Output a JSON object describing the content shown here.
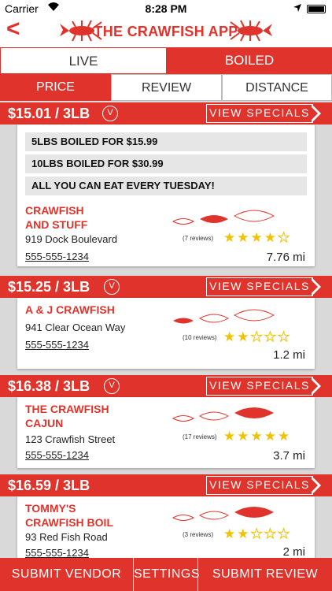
{
  "status": {
    "carrier": "Carrier",
    "time": "8:28 PM"
  },
  "header": {
    "title": "THE CRAWFISH APP"
  },
  "tabs": [
    {
      "label": "LIVE",
      "active": false
    },
    {
      "label": "BOILED",
      "active": true
    }
  ],
  "sort_tabs": [
    {
      "label": "PRICE",
      "active": true
    },
    {
      "label": "REVIEW",
      "active": false
    },
    {
      "label": "DISTANCE",
      "active": false
    }
  ],
  "specials_label": "VIEW SPECIALS",
  "vendors": [
    {
      "price": "$15.01 / 3LB",
      "specials": [
        "5LBS BOILED FOR $15.99",
        "10LBS BOILED FOR $30.99",
        "ALL YOU CAN EAT EVERY TUESDAY!"
      ],
      "name_line1": "CRAWFISH",
      "name_line2": "AND STUFF",
      "address": "919 Dock Boulevard",
      "phone": "555-555-1234",
      "reviews": "(7 reviews)",
      "rating": 4,
      "distance": "7.76 mi",
      "size_highlight": 2
    },
    {
      "price": "$15.25 / 3LB",
      "specials": [],
      "name_line1": "A & J CRAWFISH",
      "name_line2": "",
      "address": "941 Clear Ocean Way",
      "phone": "555-555-1234",
      "reviews": "(10 reviews)",
      "rating": 2,
      "distance": "1.2 mi",
      "size_highlight": 1
    },
    {
      "price": "$16.38 / 3LB",
      "specials": [],
      "name_line1": "THE CRAWFISH",
      "name_line2": "CAJUN",
      "address": "123 Crawfish Street",
      "phone": "555-555-1234",
      "reviews": "(17 reviews)",
      "rating": 5,
      "distance": "3.7 mi",
      "size_highlight": 3
    },
    {
      "price": "$16.59 / 3LB",
      "specials": [],
      "name_line1": "TOMMY'S",
      "name_line2": "CRAWFISH BOIL",
      "address": "93 Red Fish Road",
      "phone": "555-555-1234",
      "reviews": "(3 reviews)",
      "rating": 2,
      "distance": "2 mi",
      "size_highlight": 3
    }
  ],
  "bottom": [
    {
      "label": "SUBMIT VENDOR"
    },
    {
      "label": "SETTINGS"
    },
    {
      "label": "SUBMIT REVIEW"
    }
  ],
  "colors": {
    "accent": "#e0332b",
    "star": "#f2c200"
  }
}
